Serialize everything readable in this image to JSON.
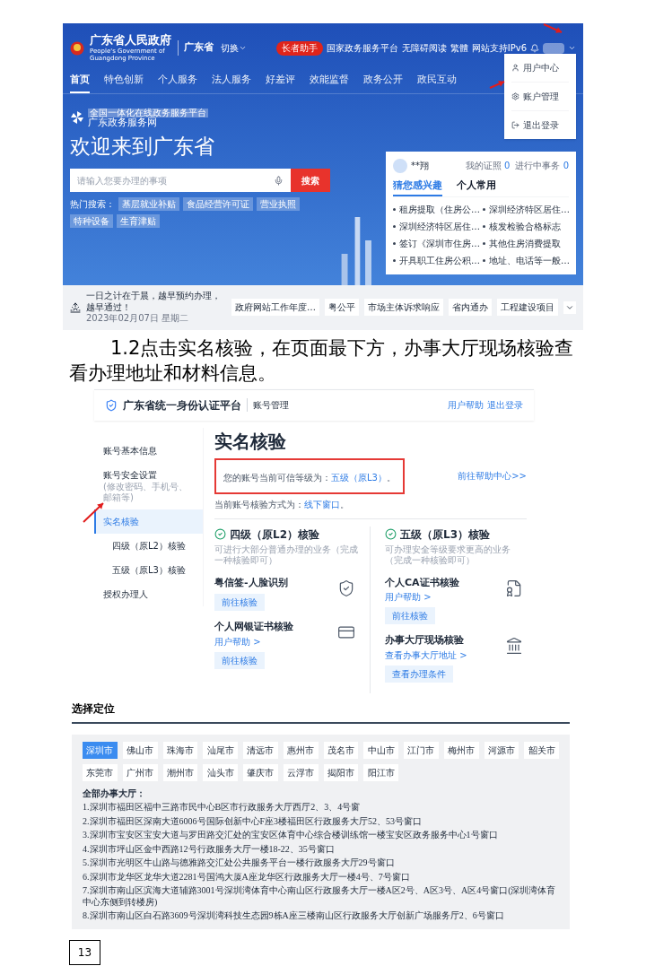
{
  "portal": {
    "site_title": "广东省人民政府",
    "site_subtitle": "People's Government of Guangdong Province",
    "region": "广东省",
    "region_switch": "切换",
    "elder_mode": "长者助手",
    "header_links": [
      "国家政务服务平台",
      "无障碍阅读",
      "繁體",
      "网站支持IPv6"
    ],
    "nav": [
      {
        "label": "首页",
        "selected": true
      },
      {
        "label": "特色创新",
        "selected": false
      },
      {
        "label": "个人服务",
        "selected": false
      },
      {
        "label": "法人服务",
        "selected": false
      },
      {
        "label": "好差评",
        "selected": false
      },
      {
        "label": "效能监督",
        "selected": false
      },
      {
        "label": "政务公开",
        "selected": false
      },
      {
        "label": "政民互动",
        "selected": false
      }
    ],
    "user_menu": [
      "用户中心",
      "账户管理",
      "退出登录"
    ],
    "platform_tag": "全国一体化在线政务服务平台",
    "platform_name": "广东政务服务网",
    "welcome": "欢迎来到广东省",
    "search": {
      "placeholder": "请输入您要办理的事项",
      "button": "搜索"
    },
    "hot_label": "热门搜索：",
    "hot_tags": [
      "基层就业补贴",
      "食品经营许可证",
      "营业执照",
      "特种设备",
      "生育津贴"
    ],
    "user_panel": {
      "name": "**翔",
      "stats": [
        {
          "label": "我的证照",
          "value": "0"
        },
        {
          "label": "进行中事务",
          "value": "0"
        }
      ],
      "tabs": [
        {
          "label": "猜您感兴趣",
          "selected": true
        },
        {
          "label": "个人常用",
          "selected": false
        }
      ],
      "items": [
        "租房提取（住房公…",
        "深圳经济特区居住…",
        "深圳经济特区居住…",
        "核发检验合格标志",
        "签订《深圳市住房…",
        "其他住房消费提取",
        "开具职工住房公积…",
        "地址、电话等一般…"
      ]
    },
    "notice": {
      "message": "一日之计在于晨，越早预约办理，越早通过！",
      "date": "2023年02月07日 星期二"
    },
    "quick_links": [
      "政府网站工作年度…",
      "粤公平",
      "市场主体诉求响应",
      "省内通办",
      "工程建设项目"
    ]
  },
  "instruction": "1.2点击实名核验，在页面最下方，办事大厅现场核验查看办理地址和材料信息。",
  "auth": {
    "platform": "广东省统一身份认证平台",
    "section": "账号管理",
    "top_links": [
      "用户帮助",
      "退出登录"
    ],
    "sidebar": [
      {
        "label": "账号基本信息",
        "selected": false
      },
      {
        "label": "账号安全设置",
        "note": "(修改密码、手机号、邮箱等)",
        "selected": false
      },
      {
        "label": "实名核验",
        "selected": true,
        "children": [
          {
            "label": "四级（原L2）核验",
            "selected": false
          },
          {
            "label": "五级（原L3）核验",
            "selected": false
          }
        ]
      },
      {
        "label": "授权办理人",
        "selected": false
      }
    ],
    "title": "实名核验",
    "level_prefix": "您的账号当前可信等级为：",
    "level_value": "五级（原L3）",
    "level_suffix": "。",
    "help_link": "前往帮助中心>>",
    "method_prefix": "当前账号核验方式为：",
    "method_value": "线下窗口",
    "method_suffix": "。",
    "columns": [
      {
        "title": "四级（原L2）核验",
        "desc": "可进行大部分普通办理的业务（完成一种核验即可）",
        "methods": [
          {
            "name": "粤信签-人脸识别",
            "button": "前往核验"
          },
          {
            "name": "个人网银证书核验",
            "link": "用户帮助 >",
            "button": "前往核验"
          }
        ]
      },
      {
        "title": "五级（原L3）核验",
        "desc": "可办理安全等级要求更高的业务（完成一种核验即可）",
        "methods": [
          {
            "name": "个人CA证书核验",
            "link": "用户帮助 >",
            "button": "前往核验"
          },
          {
            "name": "办事大厅现场核验",
            "link": "查看办事大厅地址 >",
            "button": "查看办理条件"
          }
        ]
      }
    ]
  },
  "locations": {
    "title": "选择定位",
    "cities": [
      {
        "label": "深圳市",
        "selected": true
      },
      {
        "label": "佛山市",
        "selected": false
      },
      {
        "label": "珠海市",
        "selected": false
      },
      {
        "label": "汕尾市",
        "selected": false
      },
      {
        "label": "清远市",
        "selected": false
      },
      {
        "label": "惠州市",
        "selected": false
      },
      {
        "label": "茂名市",
        "selected": false
      },
      {
        "label": "中山市",
        "selected": false
      },
      {
        "label": "江门市",
        "selected": false
      },
      {
        "label": "梅州市",
        "selected": false
      },
      {
        "label": "河源市",
        "selected": false
      },
      {
        "label": "韶关市",
        "selected": false
      },
      {
        "label": "东莞市",
        "selected": false
      },
      {
        "label": "广州市",
        "selected": false
      },
      {
        "label": "潮州市",
        "selected": false
      },
      {
        "label": "汕头市",
        "selected": false
      },
      {
        "label": "肇庆市",
        "selected": false
      },
      {
        "label": "云浮市",
        "selected": false
      },
      {
        "label": "揭阳市",
        "selected": false
      },
      {
        "label": "阳江市",
        "selected": false
      }
    ],
    "list_title": "全部办事大厅：",
    "halls": [
      "1.深圳市福田区福中三路市民中心B区市行政服务大厅西厅2、3、4号窗",
      "2.深圳市福田区深南大道6006号国际创新中心F座3楼福田区行政服务大厅52、53号窗口",
      "3.深圳市宝安区宝安大道与罗田路交汇处的宝安区体育中心综合楼训练馆一楼宝安区政务服务中心1号窗口",
      "4.深圳市坪山区金中西路12号行政服务大厅一楼18-22、35号窗口",
      "5.深圳市光明区牛山路与德雅路交汇处公共服务平台一楼行政服务大厅29号窗口",
      "6.深圳市龙华区龙华大道2281号国鸿大厦A座龙华区行政服务大厅一楼4号、7号窗口",
      "7.深圳市南山区滨海大道辅路3001号深圳湾体育中心南山区行政服务大厅一楼A区2号、A区3号、A区4号窗口(深圳湾体育中心东侧到转楼房)",
      "8.深圳市南山区白石路3609号深圳湾科技生态园9栋A座三楼南山区行政服务大厅创新广场服务厅2、6号窗口"
    ]
  },
  "page_number": "13"
}
